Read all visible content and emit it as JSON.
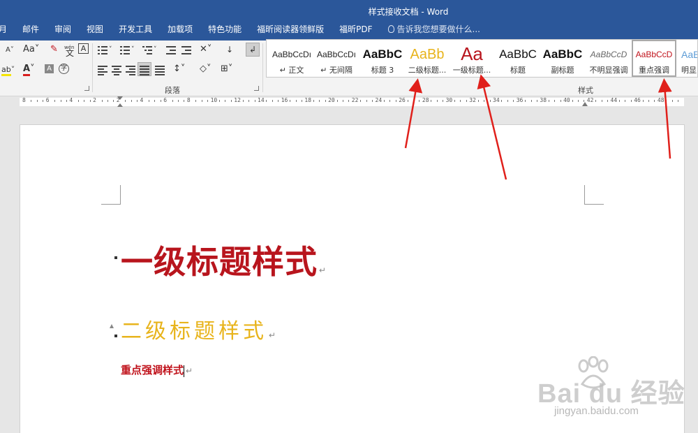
{
  "window": {
    "title": "样式接收文档 - Word"
  },
  "menu": {
    "items": [
      "月",
      "邮件",
      "审阅",
      "视图",
      "开发工具",
      "加载项",
      "特色功能",
      "福昕阅读器领鲜版",
      "福昕PDF"
    ],
    "tell_me": "告诉我您想要做什么..."
  },
  "ribbon": {
    "paragraph_group_label": "段落",
    "styles_group_label": "样式",
    "font_aa": "Aa",
    "pinyin_top": "wén",
    "pinyin_char": "文",
    "boxed_char": "A"
  },
  "styles": [
    {
      "sample": "AaBbCcDı",
      "name": "↵ 正文",
      "color": "#222222"
    },
    {
      "sample": "AaBbCcDı",
      "name": "↵ 无间隔",
      "color": "#222222"
    },
    {
      "sample": "AaBbC",
      "name": "标题 3",
      "color": "#111111"
    },
    {
      "sample": "AaBb",
      "name": "二级标题...",
      "color": "#e8b41c"
    },
    {
      "sample": "Aa",
      "name": "一级标题...",
      "color": "#b8151d"
    },
    {
      "sample": "AaBbC",
      "name": "标题",
      "color": "#111111"
    },
    {
      "sample": "AaBbC",
      "name": "副标题",
      "color": "#111111"
    },
    {
      "sample": "AaBbCcD",
      "name": "不明显强调",
      "color": "#666666"
    },
    {
      "sample": "AaBbCcD",
      "name": "重点强调",
      "color": "#c0121b"
    },
    {
      "sample": "AaBl",
      "name": "明显",
      "color": "#5b9bd5"
    }
  ],
  "ruler": {
    "numbers": [
      "8",
      "6",
      "4",
      "2",
      "2",
      "4",
      "6",
      "8",
      "10",
      "12",
      "14",
      "16",
      "18",
      "20",
      "22",
      "24",
      "26",
      "28",
      "30",
      "32",
      "34",
      "36",
      "38",
      "40",
      "42",
      "44",
      "46",
      "48"
    ]
  },
  "document": {
    "heading1": "一级标题样式",
    "heading2": "二级标题样式",
    "emphasis": "重点强调样式"
  },
  "watermark": {
    "brand": "Bai du 经验",
    "url": "jingyan.baidu.com"
  },
  "colors": {
    "titlebar": "#2b579a",
    "heading1": "#b8151d",
    "heading2": "#e8b41c",
    "emphasis": "#c0121b",
    "arrow": "#e0201b"
  }
}
